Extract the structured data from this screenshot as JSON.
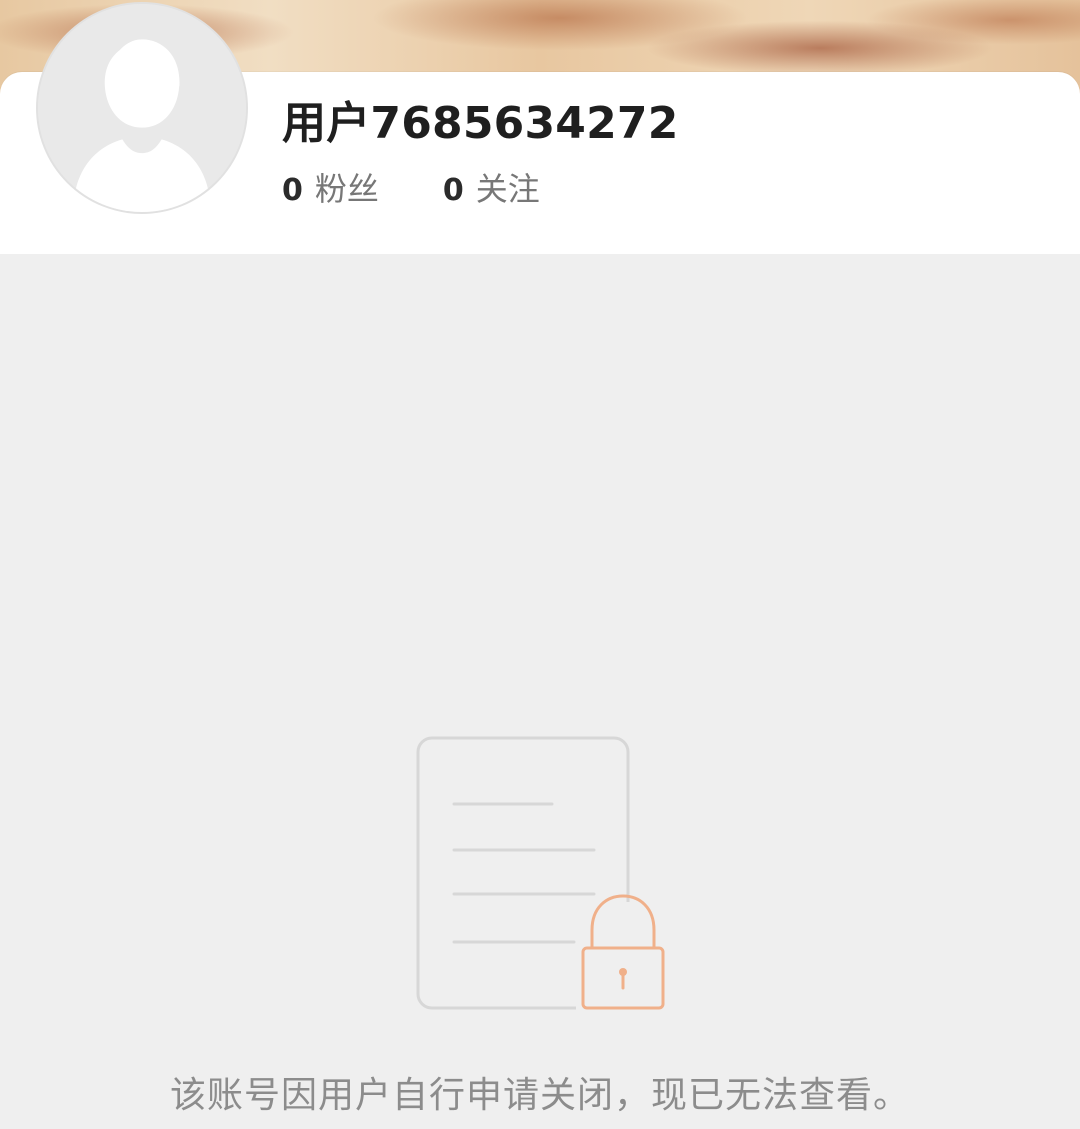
{
  "profile": {
    "username": "用户7685634272",
    "fans_count": "0",
    "fans_label": "粉丝",
    "following_count": "0",
    "following_label": "关注",
    "avatar_icon": "default-avatar-icon"
  },
  "empty_state": {
    "icon": "locked-document-icon",
    "message": "该账号因用户自行申请关闭，现已无法查看。"
  },
  "colors": {
    "background": "#efefef",
    "card": "#ffffff",
    "lock_accent": "#f0b08a",
    "doc_outline": "#d7d7d7",
    "message_text": "#8c8c8c"
  }
}
